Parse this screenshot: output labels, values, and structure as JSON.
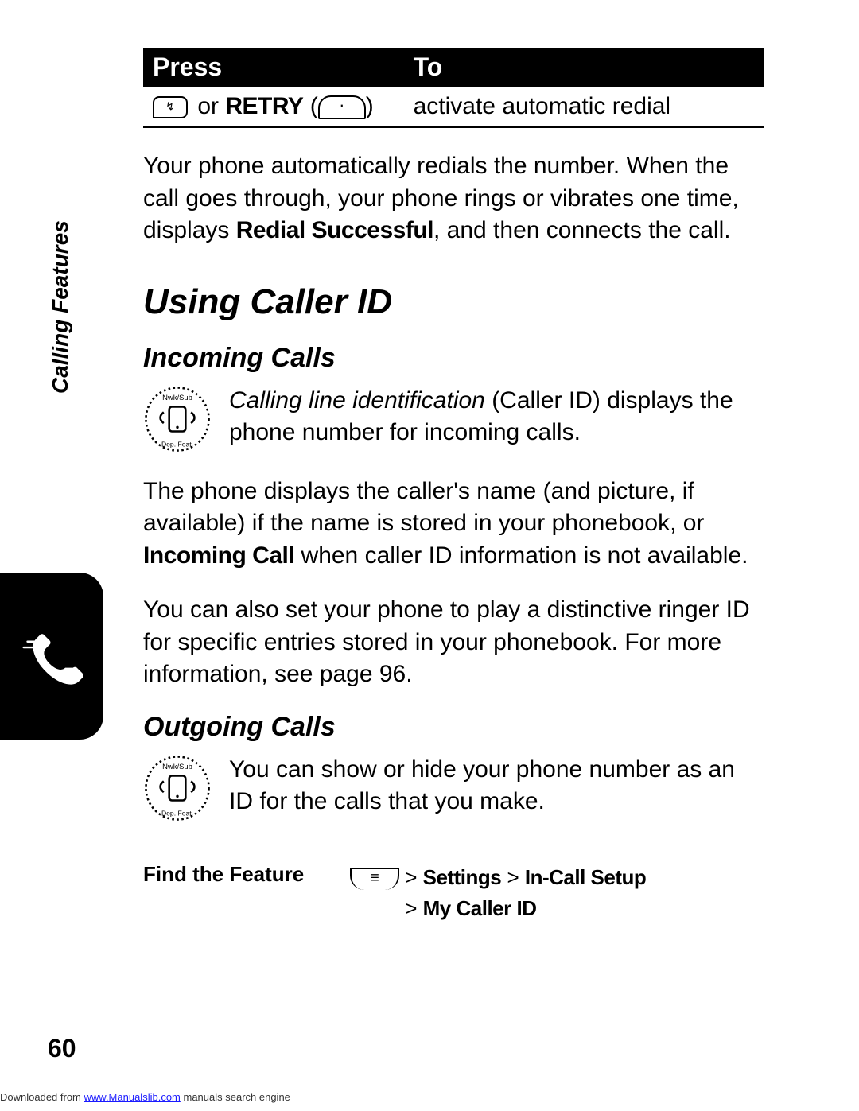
{
  "sideLabel": "Calling Features",
  "table": {
    "head": {
      "press": "Press",
      "to": "To"
    },
    "row": {
      "or": " or ",
      "retry": "RETRY",
      "openParen": " (",
      "closeParen": ")",
      "to": "activate automatic redial"
    }
  },
  "para1_a": "Your phone automatically redials the number. When the call goes through, your phone rings or vibrates one time, displays ",
  "para1_b": "Redial Successful",
  "para1_c": ", and then connects the call.",
  "h1": "Using Caller ID",
  "h2a": "Incoming Calls",
  "incoming1_a": "Calling line identification",
  "incoming1_b": " (Caller ID) displays the phone number for incoming calls.",
  "incoming2_a": "The phone displays the caller's name (and picture, if available) if the name is stored in your phonebook, or ",
  "incoming2_b": "Incoming Call",
  "incoming2_c": " when caller ID information is not available.",
  "incoming3": "You can also set your phone to play a distinctive ringer ID for specific entries stored in your phonebook. For more information, see page 96.",
  "h2b": "Outgoing Calls",
  "outgoing1": "You can show or hide your phone number as an ID for the calls that you make.",
  "findFeature": {
    "label": "Find the Feature",
    "gt": " > ",
    "p1": "Settings",
    "p2": "In-Call Setup",
    "p3": "My Caller ID"
  },
  "pageNumber": "60",
  "footer_a": "Downloaded from ",
  "footer_link": "www.Manualslib.com",
  "footer_b": " manuals search engine"
}
